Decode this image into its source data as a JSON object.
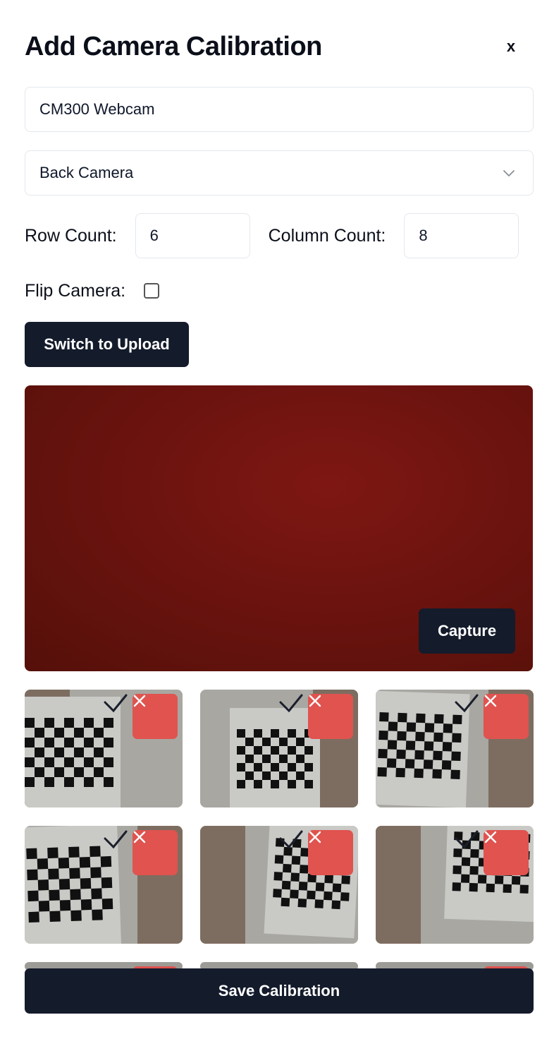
{
  "dialog": {
    "title": "Add Camera Calibration",
    "close_label": "x"
  },
  "form": {
    "camera_name": "CM300 Webcam",
    "camera_select": "Back Camera",
    "row_count_label": "Row Count:",
    "row_count": "6",
    "column_count_label": "Column Count:",
    "column_count": "8",
    "flip_label": "Flip Camera:",
    "flip_checked": false
  },
  "buttons": {
    "switch": "Switch to Upload",
    "capture": "Capture",
    "save": "Save Calibration"
  },
  "colors": {
    "primary": "#141b2b",
    "danger": "#e0534f",
    "camera_feed": "#6c130f"
  },
  "captures": [
    {
      "status_icon": "check-icon",
      "delete_icon": "close-icon"
    },
    {
      "status_icon": "check-icon",
      "delete_icon": "close-icon"
    },
    {
      "status_icon": "check-icon",
      "delete_icon": "close-icon"
    },
    {
      "status_icon": "check-icon",
      "delete_icon": "close-icon"
    },
    {
      "status_icon": "check-icon",
      "delete_icon": "close-icon"
    },
    {
      "status_icon": "check-icon",
      "delete_icon": "close-icon"
    }
  ]
}
